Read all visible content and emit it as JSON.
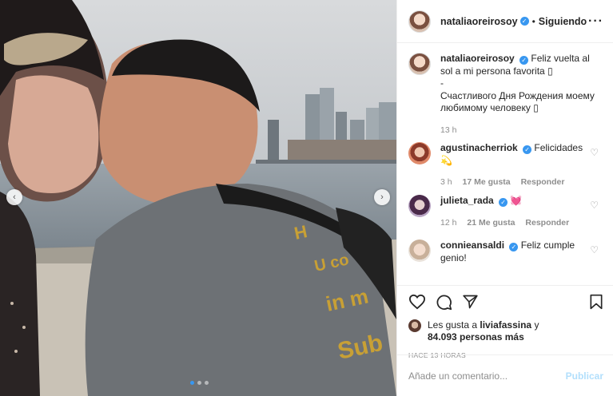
{
  "post": {
    "user": "nataliaoreirosoy",
    "follow_sep": "•",
    "follow_label": "Siguiendo",
    "more_icon": "more-horizontal-icon",
    "caption_line1": "Feliz vuelta al sol a mi persona favorita ▯",
    "caption_line2": "-",
    "caption_line3": "Счастливого Дня Рождения моему любимому человеку ▯",
    "caption_time": "13 h"
  },
  "comments": [
    {
      "user": "agustinacherriok",
      "text": "Felicidades 💫",
      "time": "3 h",
      "likes": "17 Me gusta",
      "reply": "Responder"
    },
    {
      "user": "julieta_rada",
      "text": "💓",
      "time": "12 h",
      "likes": "21 Me gusta",
      "reply": "Responder"
    },
    {
      "user": "connieansaldi",
      "text": "Feliz cumple genio!"
    }
  ],
  "actions": {
    "likes_prefix": "Les gusta a ",
    "liker": "liviafassina",
    "likes_and": " y",
    "likes_count": "84.093 personas más",
    "posted": "HACE 13 HORAS"
  },
  "composer": {
    "placeholder": "Añade un comentario...",
    "publish": "Publicar"
  },
  "colors": {
    "accent": "#3897f0",
    "publish_disabled": "#b2dffc",
    "muted": "#8e8e8e"
  }
}
